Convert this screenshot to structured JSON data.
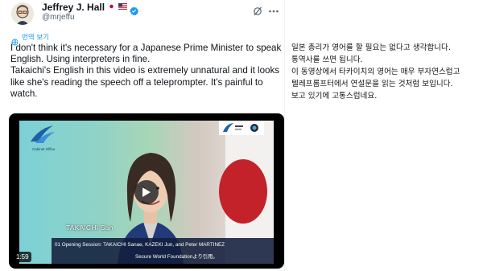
{
  "tweet": {
    "author_name": "Jeffrey J. Hall",
    "handle": "@mrjeffu",
    "translate_label": "번역 보기",
    "text_lines": [
      "I don't think it's necessary for a Japanese Prime Minister to speak English. Using interpreters in fine.",
      "Takaichi's English in this video is extremely unnatural and it looks like she's reading the speech off a teleprompter. It's painful to watch."
    ],
    "flags": [
      "Japan flag",
      "US flag"
    ],
    "icons": [
      "grok-icon",
      "more-icon",
      "verified-icon",
      "globe-icon",
      "play-icon"
    ]
  },
  "video": {
    "duration": "1:59",
    "logo_caption": "Cabinet Office",
    "speaker_caption": "TAKAICHI San",
    "session_title": "01  Opening Session: TAKAICHI Sanae, KAZEKI Jun, and Peter MARTINEZ",
    "session_subtitle": "Secure World Foundationより引用。"
  },
  "translation": {
    "lines": [
      "일본 총리가 영어를 할 필요는 없다고 생각합니다.",
      "통역사를 쓰면 됩니다.",
      "이 동영상에서 타카이치의 영어는 매우 부자연스럽고",
      "텔레프롬프터에서 연설문을 읽는 것처럼 보입니다.",
      "보고 있기에 고통스럽네요."
    ]
  },
  "colors": {
    "link_blue": "#1d9bf0",
    "verified_blue": "#1d9bf0",
    "secondary_text": "#536471"
  }
}
